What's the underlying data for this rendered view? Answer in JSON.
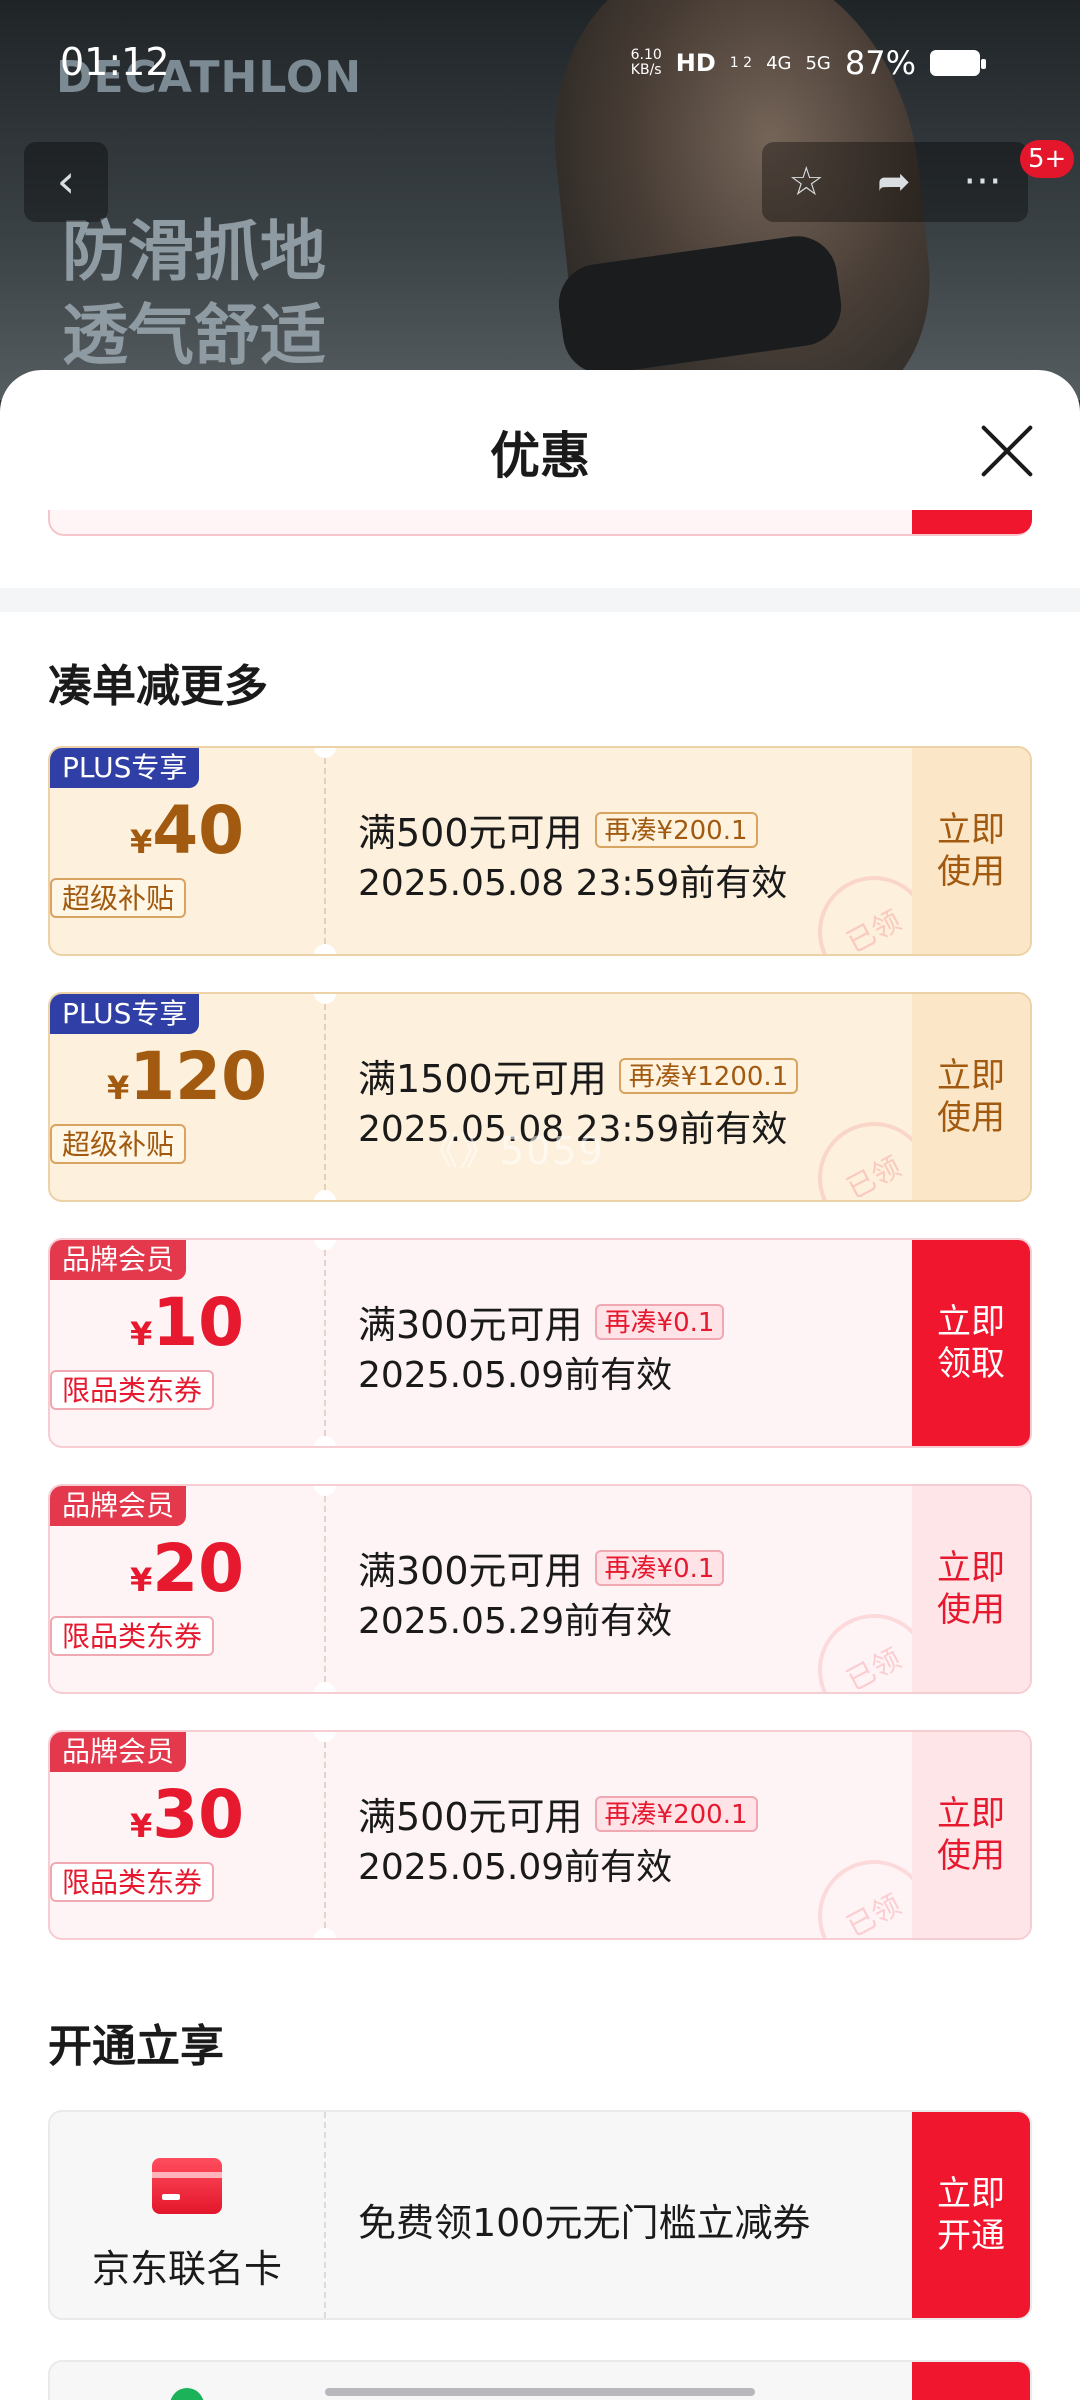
{
  "status_bar": {
    "time": "01:12",
    "net_speed_value": "6.10",
    "net_speed_unit": "KB/s",
    "hd": "HD",
    "hd_sub": "1 2",
    "sig4g": "4G",
    "sig5g": "5G",
    "battery": "87%"
  },
  "hero": {
    "brand": "DECATHLON",
    "slogan_line1": "防滑抓地",
    "slogan_line2": "透气舒适"
  },
  "nav": {
    "back_glyph": "‹",
    "favorite_glyph": "☆",
    "share_glyph": "➦",
    "more_glyph": "···",
    "badge": "5+"
  },
  "sheet": {
    "title": "优惠"
  },
  "section_more": {
    "title": "凑单减更多"
  },
  "coupons": [
    {
      "tag": "PLUS专享",
      "yen": "¥",
      "amount": "40",
      "sub": "超级补贴",
      "condition": "满500元可用",
      "diff": "再凑¥200.1",
      "valid": "2025.05.08 23:59前有效",
      "action": "立即\n使用",
      "stamp": "已领"
    },
    {
      "tag": "PLUS专享",
      "yen": "¥",
      "amount": "120",
      "sub": "超级补贴",
      "condition": "满1500元可用",
      "diff": "再凑¥1200.1",
      "valid": "2025.05.08 23:59前有效",
      "action": "立即\n使用",
      "stamp": "已领"
    },
    {
      "tag": "品牌会员",
      "yen": "¥",
      "amount": "10",
      "sub": "限品类东券",
      "condition": "满300元可用",
      "diff": "再凑¥0.1",
      "valid": "2025.05.09前有效",
      "action": "立即\n领取"
    },
    {
      "tag": "品牌会员",
      "yen": "¥",
      "amount": "20",
      "sub": "限品类东券",
      "condition": "满300元可用",
      "diff": "再凑¥0.1",
      "valid": "2025.05.29前有效",
      "action": "立即\n使用",
      "stamp": "已领"
    },
    {
      "tag": "品牌会员",
      "yen": "¥",
      "amount": "30",
      "sub": "限品类东券",
      "condition": "满500元可用",
      "diff": "再凑¥200.1",
      "valid": "2025.05.09前有效",
      "action": "立即\n使用",
      "stamp": "已领"
    }
  ],
  "section_open": {
    "title": "开通立享"
  },
  "open_card": {
    "name": "京东联名卡",
    "desc": "免费领100元无门槛立减券",
    "action": "立即\n开通"
  },
  "watermark": "《》5059",
  "colors": {
    "brand_red": "#f0162e",
    "plus_blue": "#2f3fa6",
    "gold_text": "#a15a10"
  }
}
